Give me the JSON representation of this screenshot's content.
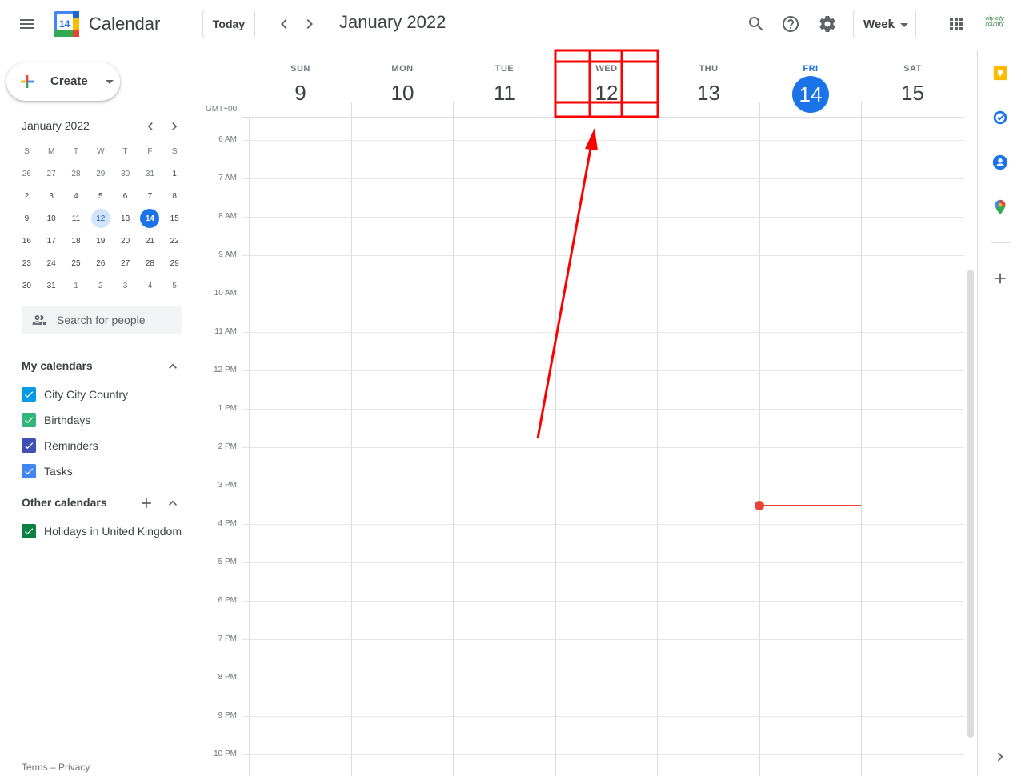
{
  "header": {
    "app_title": "Calendar",
    "logo_day": "14",
    "today_label": "Today",
    "month_title": "January 2022",
    "view_label": "Week",
    "account_logo_text": "city city country",
    "icons": [
      "main-menu-icon",
      "chevron-left-icon",
      "chevron-right-icon",
      "search-icon",
      "help-icon",
      "settings-icon",
      "apps-grid-icon"
    ]
  },
  "sidebar": {
    "create_label": "Create",
    "mini_calendar": {
      "title": "January 2022",
      "weekdays": [
        "S",
        "M",
        "T",
        "W",
        "T",
        "F",
        "S"
      ],
      "weeks": [
        [
          "26",
          "27",
          "28",
          "29",
          "30",
          "31",
          "1"
        ],
        [
          "2",
          "3",
          "4",
          "5",
          "6",
          "7",
          "8"
        ],
        [
          "9",
          "10",
          "11",
          "12",
          "13",
          "14",
          "15"
        ],
        [
          "16",
          "17",
          "18",
          "19",
          "20",
          "21",
          "22"
        ],
        [
          "23",
          "24",
          "25",
          "26",
          "27",
          "28",
          "29"
        ],
        [
          "30",
          "31",
          "1",
          "2",
          "3",
          "4",
          "5"
        ]
      ],
      "today": "14",
      "selected": "12"
    },
    "people_search_placeholder": "Search for people",
    "my_calendars": {
      "title": "My calendars",
      "items": [
        {
          "name": "City City Country",
          "color": "#039be5"
        },
        {
          "name": "Birthdays",
          "color": "#33b679"
        },
        {
          "name": "Reminders",
          "color": "#3f51b5"
        },
        {
          "name": "Tasks",
          "color": "#4285f4"
        }
      ]
    },
    "other_calendars": {
      "title": "Other calendars",
      "items": [
        {
          "name": "Holidays in United Kingdom",
          "color": "#0b8043"
        }
      ]
    },
    "footer": {
      "terms": "Terms",
      "sep": "–",
      "privacy": "Privacy"
    }
  },
  "week": {
    "timezone": "GMT+00",
    "days": [
      {
        "dow": "SUN",
        "num": "9"
      },
      {
        "dow": "MON",
        "num": "10"
      },
      {
        "dow": "TUE",
        "num": "11"
      },
      {
        "dow": "WED",
        "num": "12"
      },
      {
        "dow": "THU",
        "num": "13"
      },
      {
        "dow": "FRI",
        "num": "14",
        "today": true
      },
      {
        "dow": "SAT",
        "num": "15"
      }
    ],
    "hours": [
      "6 AM",
      "7 AM",
      "8 AM",
      "9 AM",
      "10 AM",
      "11 AM",
      "12 PM",
      "1 PM",
      "2 PM",
      "3 PM",
      "4 PM",
      "5 PM",
      "6 PM",
      "7 PM",
      "8 PM",
      "9 PM",
      "10 PM"
    ]
  },
  "colors": {
    "accent": "#1a73e8",
    "current_time": "#ea4335",
    "annotation": "#ff0000"
  },
  "right_rail": {
    "icons": [
      "keep-icon",
      "tasks-icon",
      "contacts-icon",
      "maps-icon",
      "add-icon",
      "expand-panel-icon"
    ]
  }
}
